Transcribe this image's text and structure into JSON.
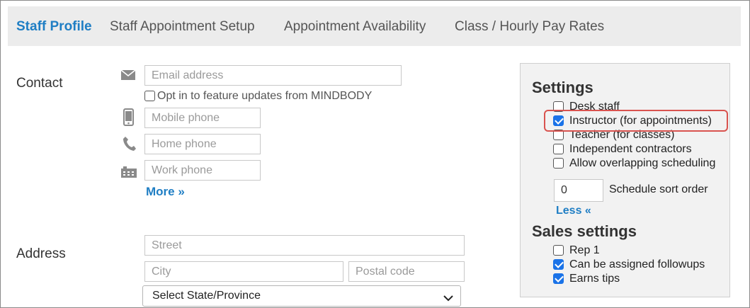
{
  "tabs": [
    {
      "label": "Staff Profile",
      "active": true
    },
    {
      "label": "Staff Appointment Setup",
      "active": false
    },
    {
      "label": "Appointment Availability",
      "active": false
    },
    {
      "label": "Class / Hourly Pay Rates",
      "active": false
    }
  ],
  "contact": {
    "label": "Contact",
    "email_placeholder": "Email address",
    "opt_in_label": "Opt in to feature updates from MINDBODY",
    "mobile_placeholder": "Mobile phone",
    "home_placeholder": "Home phone",
    "work_placeholder": "Work phone",
    "more_link": "More »"
  },
  "address": {
    "label": "Address",
    "street_placeholder": "Street",
    "city_placeholder": "City",
    "postal_placeholder": "Postal code",
    "state_selected": "Select State/Province"
  },
  "settings": {
    "heading": "Settings",
    "options": [
      {
        "label": "Desk staff",
        "checked": false
      },
      {
        "label": "Instructor (for appointments)",
        "checked": true
      },
      {
        "label": "Teacher (for classes)",
        "checked": false
      },
      {
        "label": "Independent contractors",
        "checked": false
      },
      {
        "label": "Allow overlapping scheduling",
        "checked": false
      }
    ],
    "sort_order_value": "0",
    "sort_order_label": "Schedule sort order",
    "less_link": "Less «"
  },
  "sales_settings": {
    "heading": "Sales settings",
    "options": [
      {
        "label": "Rep 1",
        "checked": false
      },
      {
        "label": "Can be assigned followups",
        "checked": true
      },
      {
        "label": "Earns tips",
        "checked": true
      }
    ]
  },
  "colors": {
    "accent": "#1f7ec4",
    "highlight": "#d9534f",
    "checkbox": "#1a73e8"
  }
}
